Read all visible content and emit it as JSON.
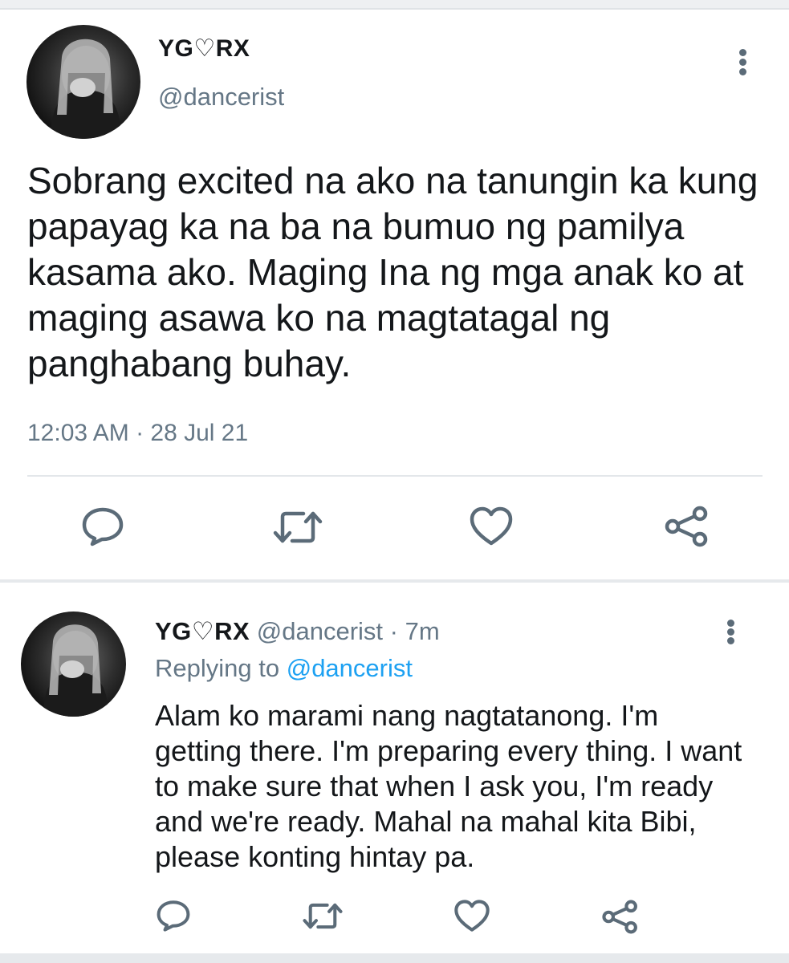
{
  "main_tweet": {
    "display_name": "YG♡RX",
    "handle": "@dancerist",
    "text": "Sobrang excited na ako na tanungin ka kung papayag ka na ba na bumuo ng pamilya kasama ako. Maging Ina ng mga anak ko at maging asawa ko na magtatagal ng panghabang buhay.",
    "timestamp": "12:03 AM · 28 Jul 21",
    "actions": [
      "reply-icon",
      "retweet-icon",
      "like-icon",
      "share-icon"
    ]
  },
  "reply_tweet": {
    "display_name": "YG♡RX",
    "handle": "@dancerist",
    "separator": " · ",
    "age": "7m",
    "replying_prefix": "Replying to ",
    "replying_to": "@dancerist",
    "text": "Alam ko marami nang nagtatanong. I'm getting there. I'm preparing every thing. I want to make sure that when I ask you, I'm ready and we're ready. Mahal na mahal kita Bibi, please konting hintay pa.",
    "actions": [
      "reply-icon",
      "retweet-icon",
      "like-icon",
      "share-icon"
    ]
  },
  "colors": {
    "text_primary": "#14171a",
    "text_secondary": "#657786",
    "mention": "#1da1f2",
    "icon": "#5b6b78",
    "divider": "#e3e7ea"
  }
}
